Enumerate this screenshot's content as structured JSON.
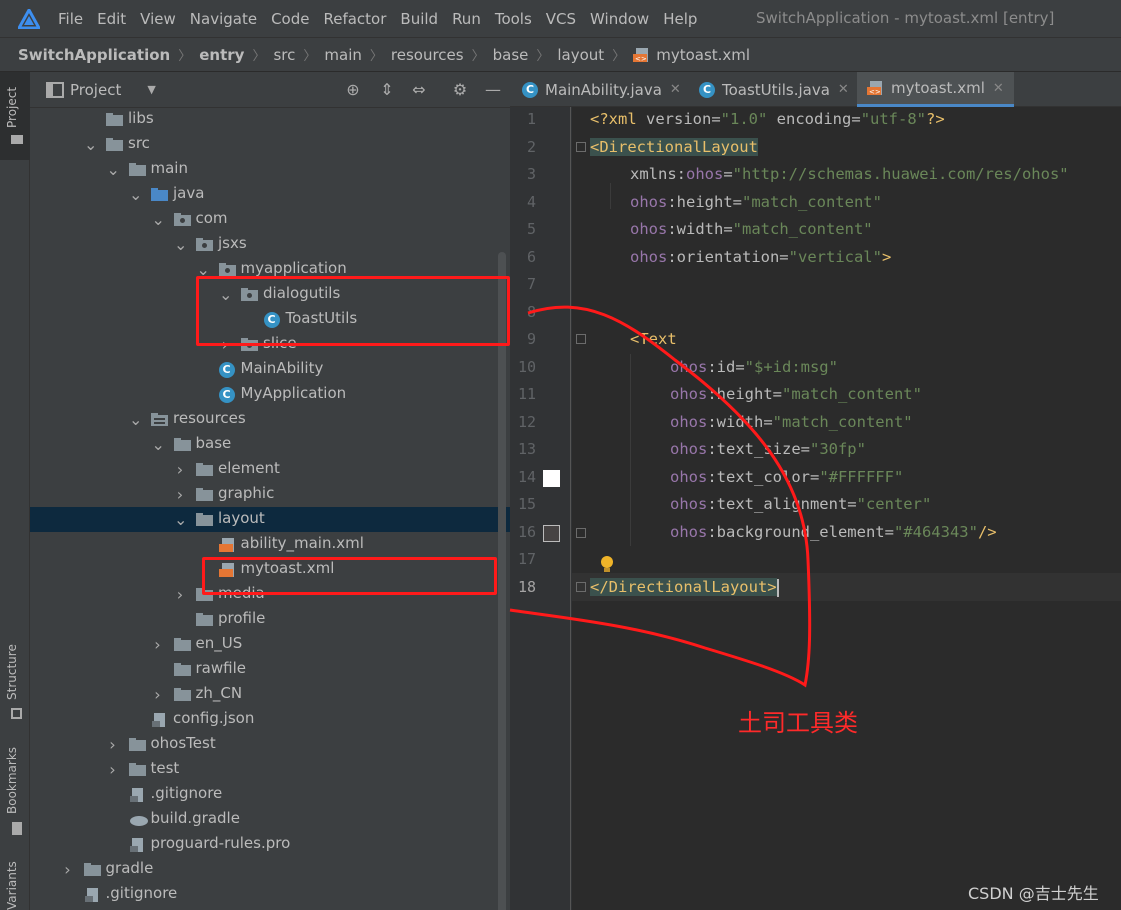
{
  "menubar": {
    "items": [
      "File",
      "Edit",
      "View",
      "Navigate",
      "Code",
      "Refactor",
      "Build",
      "Run",
      "Tools",
      "VCS",
      "Window",
      "Help"
    ],
    "window_title": "SwitchApplication - mytoast.xml [entry]"
  },
  "breadcrumb": [
    "SwitchApplication",
    "entry",
    "src",
    "main",
    "resources",
    "base",
    "layout",
    "mytoast.xml"
  ],
  "left_strip": {
    "tabs": [
      "Project",
      "Structure",
      "Bookmarks",
      "Variants"
    ]
  },
  "project_panel": {
    "title": "Project",
    "tree": [
      {
        "label": "libs",
        "icon": "folder-icon"
      },
      {
        "label": "src",
        "icon": "folder-icon"
      },
      {
        "label": "main",
        "icon": "folder-icon"
      },
      {
        "label": "java",
        "icon": "source-folder-icon"
      },
      {
        "label": "com",
        "icon": "package-icon"
      },
      {
        "label": "jsxs",
        "icon": "package-icon"
      },
      {
        "label": "myapplication",
        "icon": "package-icon"
      },
      {
        "label": "dialogutils",
        "icon": "package-icon"
      },
      {
        "label": "ToastUtils",
        "icon": "class-icon"
      },
      {
        "label": "slice",
        "icon": "package-icon"
      },
      {
        "label": "MainAbility",
        "icon": "class-icon"
      },
      {
        "label": "MyApplication",
        "icon": "class-icon"
      },
      {
        "label": "resources",
        "icon": "resources-folder-icon"
      },
      {
        "label": "base",
        "icon": "folder-icon"
      },
      {
        "label": "element",
        "icon": "folder-icon"
      },
      {
        "label": "graphic",
        "icon": "folder-icon"
      },
      {
        "label": "layout",
        "icon": "folder-icon"
      },
      {
        "label": "ability_main.xml",
        "icon": "xml-file-icon"
      },
      {
        "label": "mytoast.xml",
        "icon": "xml-file-icon"
      },
      {
        "label": "media",
        "icon": "folder-icon"
      },
      {
        "label": "profile",
        "icon": "folder-icon"
      },
      {
        "label": "en_US",
        "icon": "folder-icon"
      },
      {
        "label": "rawfile",
        "icon": "folder-icon"
      },
      {
        "label": "zh_CN",
        "icon": "folder-icon"
      },
      {
        "label": "config.json",
        "icon": "json-file-icon"
      },
      {
        "label": "ohosTest",
        "icon": "folder-icon"
      },
      {
        "label": "test",
        "icon": "folder-icon"
      },
      {
        "label": ".gitignore",
        "icon": "gitignore-file-icon"
      },
      {
        "label": "build.gradle",
        "icon": "gradle-file-icon"
      },
      {
        "label": "proguard-rules.pro",
        "icon": "text-file-icon"
      },
      {
        "label": "gradle",
        "icon": "folder-icon"
      },
      {
        "label": ".gitignore",
        "icon": "gitignore-file-icon"
      }
    ]
  },
  "editor": {
    "tabs": [
      {
        "label": "MainAbility.java",
        "icon": "class-icon"
      },
      {
        "label": "ToastUtils.java",
        "icon": "class-icon"
      },
      {
        "label": "mytoast.xml",
        "icon": "xml-file-icon",
        "active": true
      }
    ],
    "line_numbers": [
      "1",
      "2",
      "3",
      "4",
      "5",
      "6",
      "7",
      "8",
      "9",
      "10",
      "11",
      "12",
      "13",
      "14",
      "15",
      "16",
      "17",
      "18"
    ],
    "lines": {
      "l1_a": "<?xml ",
      "l1_b": "version",
      "l1_c": "=",
      "l1_d": "\"1.0\"",
      "l1_e": " encoding",
      "l1_f": "=",
      "l1_g": "\"utf-8\"",
      "l1_h": "?>",
      "l2_a": "<DirectionalLayout",
      "l3_a": "xmlns:",
      "l3_b": "ohos",
      "l3_c": "=",
      "l3_d": "\"http://schemas.huawei.com/res/ohos\"",
      "l4_a": "ohos",
      "l4_b": ":height=",
      "l4_c": "\"match_content\"",
      "l5_a": "ohos",
      "l5_b": ":width=",
      "l5_c": "\"match_content\"",
      "l6_a": "ohos",
      "l6_b": ":orientation=",
      "l6_c": "\"vertical\"",
      "l6_d": ">",
      "l9_a": "<Text",
      "l10_a": "ohos",
      "l10_b": ":id=",
      "l10_c": "\"$+id:msg\"",
      "l11_a": "ohos",
      "l11_b": ":height=",
      "l11_c": "\"match_content\"",
      "l12_a": "ohos",
      "l12_b": ":width=",
      "l12_c": "\"match_content\"",
      "l13_a": "ohos",
      "l13_b": ":text_size=",
      "l13_c": "\"30fp\"",
      "l14_a": "ohos",
      "l14_b": ":text_color=",
      "l14_c": "\"#FFFFFF\"",
      "l15_a": "ohos",
      "l15_b": ":text_alignment=",
      "l15_c": "\"center\"",
      "l16_a": "ohos",
      "l16_b": ":background_element=",
      "l16_c": "\"#464343\"",
      "l16_d": "/>",
      "l18_a": "</DirectionalLayout>"
    },
    "color_swatches": {
      "line14": "#FFFFFF",
      "line16": "#464343"
    }
  },
  "annotation": {
    "text": "土司工具类",
    "color": "#ff2a2a"
  },
  "watermark": "CSDN @吉士先生",
  "colors": {
    "accent": "#4a88c7",
    "selection": "#0d293e",
    "annotation_red": "#ff1a1a"
  }
}
